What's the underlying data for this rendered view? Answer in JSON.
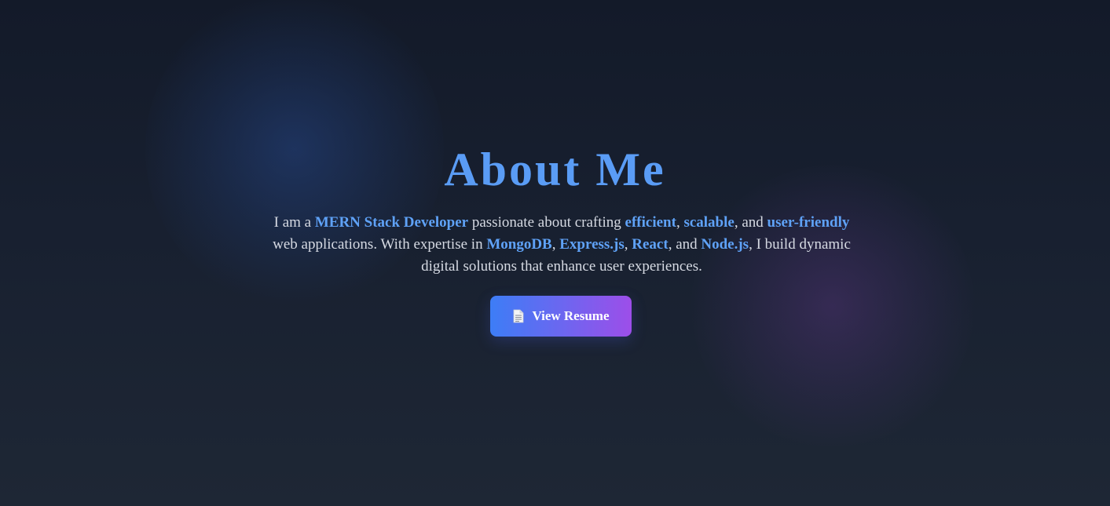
{
  "about": {
    "title": "About Me",
    "intro": {
      "t1": "I am a ",
      "h1": "MERN Stack Developer",
      "t2": " passionate about crafting ",
      "h2": "efficient",
      "t3": ", ",
      "h3": "scalable",
      "t4": ", and ",
      "h4": "user-friendly",
      "t5": " web applications. With expertise in ",
      "h5": "MongoDB",
      "t6": ", ",
      "h6": "Express.js",
      "t7": ", ",
      "h7": "React",
      "t8": ", and ",
      "h8": "Node.js",
      "t9": ", I build dynamic digital solutions that enhance user experiences."
    },
    "resume_button": {
      "icon": "document-icon",
      "label": "View Resume"
    }
  },
  "colors": {
    "heading": "#5a9cf5",
    "highlight": "#5fa2f7",
    "button_gradient_start": "#3d7df6",
    "button_gradient_end": "#9d4ee9",
    "background": "#182030"
  }
}
